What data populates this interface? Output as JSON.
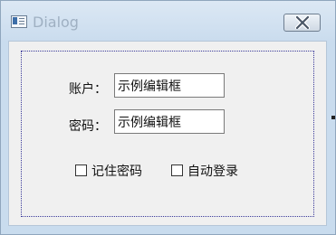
{
  "window": {
    "title": "Dialog"
  },
  "form": {
    "account_label": "账户：",
    "account_value": "示例编辑框",
    "password_label": "密码：",
    "password_value": "示例编辑框"
  },
  "options": {
    "remember_password_label": "记住密码",
    "remember_password_checked": false,
    "auto_login_label": "自动登录",
    "auto_login_checked": false
  },
  "icons": {
    "app": "dialog-app-icon",
    "close": "close-icon"
  },
  "colors": {
    "title_text": "#9fb0c2",
    "frame": "#c9dcee",
    "client_bg": "#f0f0f0",
    "focus_rect": "#3a3a9a"
  }
}
